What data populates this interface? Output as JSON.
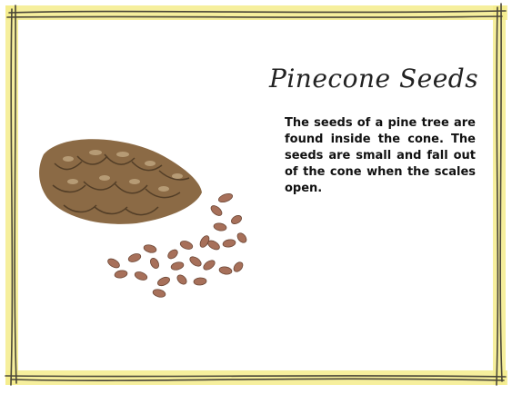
{
  "title": "Pinecone Seeds",
  "body": "The seeds of a pine tree are found inside the cone. The seeds are small and fall out of the cone when the scales open.",
  "colors": {
    "frame_yellow": "#f4ec8c",
    "frame_stroke": "#4a4638",
    "cone": "#8b6a45",
    "seed": "#a7705a"
  },
  "icons": [
    "pinecone-image",
    "pine-seed-image"
  ]
}
